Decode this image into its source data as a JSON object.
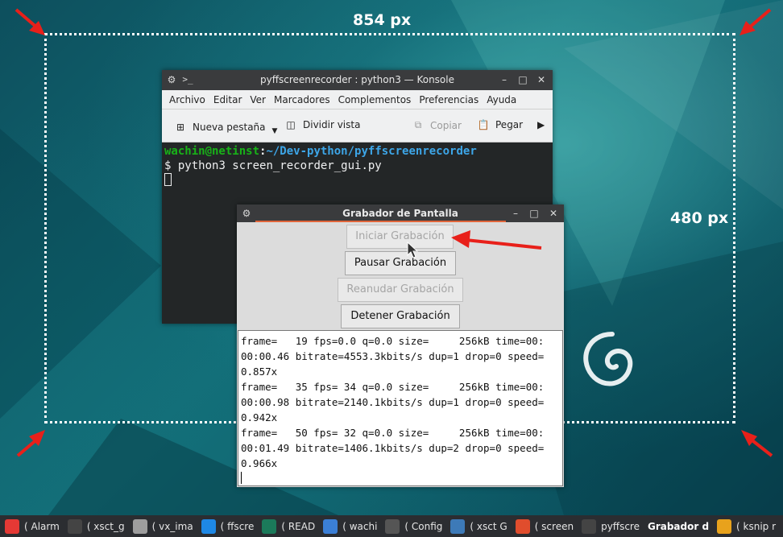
{
  "annotations": {
    "width_label": "854 px",
    "height_label": "480 px"
  },
  "konsole": {
    "title": "pyffscreenrecorder : python3 — Konsole",
    "menu": [
      "Archivo",
      "Editar",
      "Ver",
      "Marcadores",
      "Complementos",
      "Preferencias",
      "Ayuda"
    ],
    "toolbar": {
      "new_tab": "Nueva pestaña",
      "split_view": "Dividir vista",
      "copy": "Copiar",
      "paste": "Pegar"
    },
    "terminal": {
      "user_host": "wachin@netinst",
      "path": "~/Dev-python/pyffscreenrecorder",
      "prompt": "$",
      "command": "python3 screen_recorder_gui.py"
    }
  },
  "grabador": {
    "title": "Grabador de Pantalla",
    "buttons": {
      "start": "Iniciar Grabación",
      "pause": "Pausar Grabación",
      "resume": "Reanudar Grabación",
      "stop": "Detener Grabación"
    },
    "log_lines": [
      "frame=   19 fps=0.0 q=0.0 size=     256kB time=00:",
      "00:00.46 bitrate=4553.3kbits/s dup=1 drop=0 speed=",
      "0.857x",
      "frame=   35 fps= 34 q=0.0 size=     256kB time=00:",
      "00:00.98 bitrate=2140.1kbits/s dup=1 drop=0 speed=",
      "0.942x",
      "frame=   50 fps= 32 q=0.0 size=     256kB time=00:",
      "00:01.49 bitrate=1406.1kbits/s dup=2 drop=0 speed=",
      "0.966x"
    ]
  },
  "taskbar": {
    "items": [
      {
        "label": "( Alarm",
        "icon": "alarm-icon",
        "color": "#e53935"
      },
      {
        "label": "( xsct_g",
        "icon": "terminal-icon",
        "color": "#444444"
      },
      {
        "label": "( vx_ima",
        "icon": "notes-icon",
        "color": "#9e9e9e"
      },
      {
        "label": "( ffscre",
        "icon": "browser-icon",
        "color": "#1e88e5"
      },
      {
        "label": "( READ",
        "icon": "editor-icon",
        "color": "#1b7a5a"
      },
      {
        "label": "( wachi",
        "icon": "chromium-icon",
        "color": "#3b7fd6"
      },
      {
        "label": "( Config",
        "icon": "settings-icon",
        "color": "#555555"
      },
      {
        "label": "( xsct G",
        "icon": "python-icon",
        "color": "#3d7ab8"
      },
      {
        "label": "( screen",
        "icon": "apps-icon",
        "color": "#e04d2d"
      },
      {
        "label": "pyffscre",
        "icon": "terminal-icon",
        "color": "#444444"
      },
      {
        "label": "Grabador d",
        "icon": "",
        "color": ""
      },
      {
        "label": "( ksnip r",
        "icon": "ksnip-icon",
        "color": "#e8a21c"
      }
    ],
    "active_index": 10
  }
}
